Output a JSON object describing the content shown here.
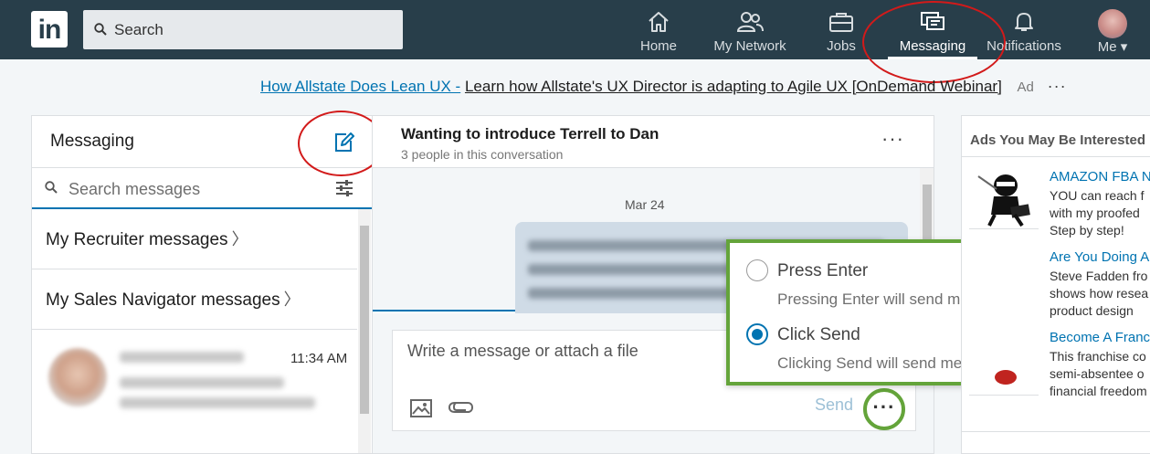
{
  "nav": {
    "logo": "in",
    "search_placeholder": "Search",
    "items": [
      {
        "label": "Home",
        "icon": "home-icon"
      },
      {
        "label": "My Network",
        "icon": "network-icon"
      },
      {
        "label": "Jobs",
        "icon": "briefcase-icon"
      },
      {
        "label": "Messaging",
        "icon": "messaging-icon",
        "active": true
      },
      {
        "label": "Notifications",
        "icon": "bell-icon"
      },
      {
        "label": "Me ▾",
        "icon": "avatar"
      }
    ]
  },
  "ad_banner": {
    "link_title": "How Allstate Does Lean UX -",
    "text": "Learn how Allstate's UX Director is adapting to Agile UX [OnDemand Webinar]",
    "tag": "Ad",
    "more": "···"
  },
  "messaging": {
    "title": "Messaging",
    "search_placeholder": "Search messages",
    "rows": [
      {
        "label": "My Recruiter messages",
        "chev": "〉"
      },
      {
        "label": "My Sales Navigator messages",
        "chev": "〉"
      }
    ],
    "conversation": {
      "time": "11:34 AM"
    }
  },
  "conversation": {
    "title": "Wanting to introduce Terrell to Dan",
    "subtitle": "3 people in this conversation",
    "more": "···",
    "date": "Mar 24",
    "composer_placeholder": "Write a message or attach a file",
    "send_label": "Send",
    "more_options": "···"
  },
  "send_options": [
    {
      "title": "Press Enter",
      "desc": "Pressing Enter will send message",
      "selected": false
    },
    {
      "title": "Click Send",
      "desc": "Clicking Send will send message",
      "selected": true
    }
  ],
  "right_ads": {
    "heading": "Ads You May Be Interested In",
    "ads": [
      {
        "title": "AMAZON FBA N",
        "lines": [
          "YOU can reach f",
          "with my proofed",
          "Step by step!"
        ]
      },
      {
        "title": "Are You Doing A",
        "lines": [
          "Steve Fadden fro",
          "shows how resea",
          "product design"
        ]
      },
      {
        "title": "Become A Franc",
        "lines": [
          "This franchise co",
          "semi-absentee o",
          "financial freedom"
        ]
      }
    ]
  },
  "colors": {
    "nav_bg": "#283e4a",
    "brand_blue": "#0073b1",
    "highlight_green": "#64a43a",
    "annotation_red": "#d21a1a"
  }
}
